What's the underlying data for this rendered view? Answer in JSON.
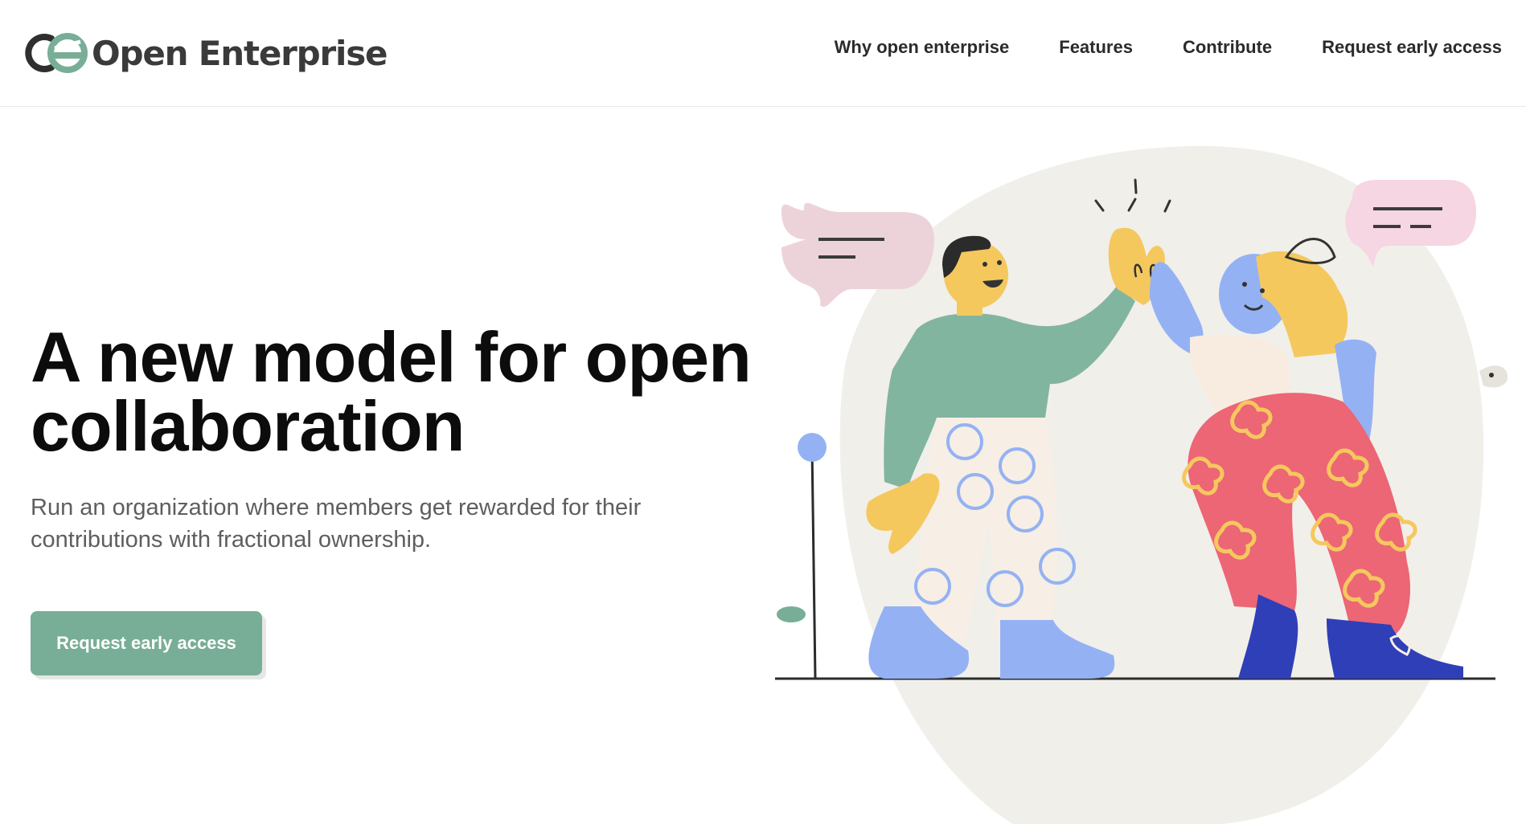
{
  "brand": {
    "name": "Open Enterprise",
    "logo_icon": "oe-logo-icon",
    "colors": {
      "dark": "#2f2f2f",
      "green": "#78ae97"
    }
  },
  "nav": {
    "items": [
      {
        "label": "Why open enterprise"
      },
      {
        "label": "Features"
      },
      {
        "label": "Contribute"
      },
      {
        "label": "Request early access"
      }
    ]
  },
  "hero": {
    "title": "A new model for open collaboration",
    "subtitle": "Run an organization where members get rewarded for their contributions with fractional ownership.",
    "cta_label": "Request early access",
    "cta_color": "#78ae97"
  },
  "illustration": {
    "name": "high-five-illustration",
    "colors": {
      "blob": "#f1efea",
      "bubble_left": "#ecd3da",
      "bubble_right": "#f6d6e2",
      "green": "#82b59f",
      "yellow": "#f5c85e",
      "blue": "#94b2f3",
      "red": "#ec6675",
      "navy": "#2f3fb8"
    }
  }
}
